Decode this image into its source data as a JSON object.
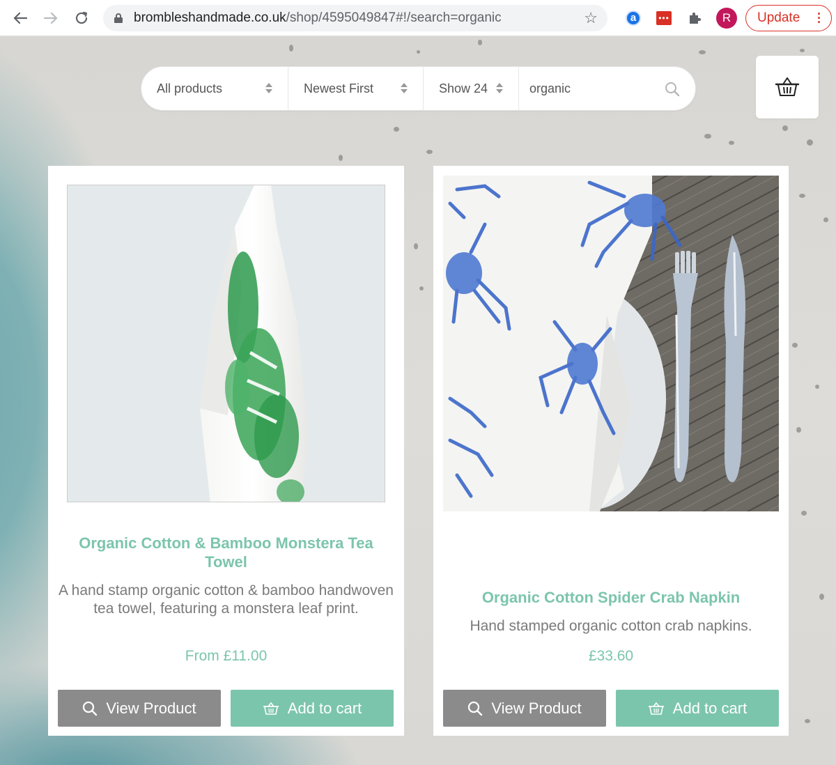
{
  "browser": {
    "url_domain": "brombleshandmade.co.uk",
    "url_path": "/shop/4595049847#!/search=organic",
    "profile_initial": "R",
    "update_label": "Update",
    "ext_a_label": "a",
    "ext_dots_label": "•••"
  },
  "filters": {
    "category": "All products",
    "sort": "Newest First",
    "show": "Show 24",
    "search_value": "organic"
  },
  "products": [
    {
      "title": "Organic Cotton & Bamboo Monstera Tea Towel",
      "description": "A hand stamp organic cotton & bamboo handwoven tea towel, featuring a monstera leaf print.",
      "price": "From £11.00",
      "view_label": "View Product",
      "cart_label": "Add to cart"
    },
    {
      "title": "Organic Cotton Spider Crab Napkin",
      "description": "Hand stamped organic cotton crab napkins.",
      "price": "£33.60",
      "view_label": "View Product",
      "cart_label": "Add to cart"
    }
  ],
  "colors": {
    "accent": "#7cc5ad",
    "view_button": "#8b8b8b",
    "update_red": "#d93025"
  }
}
